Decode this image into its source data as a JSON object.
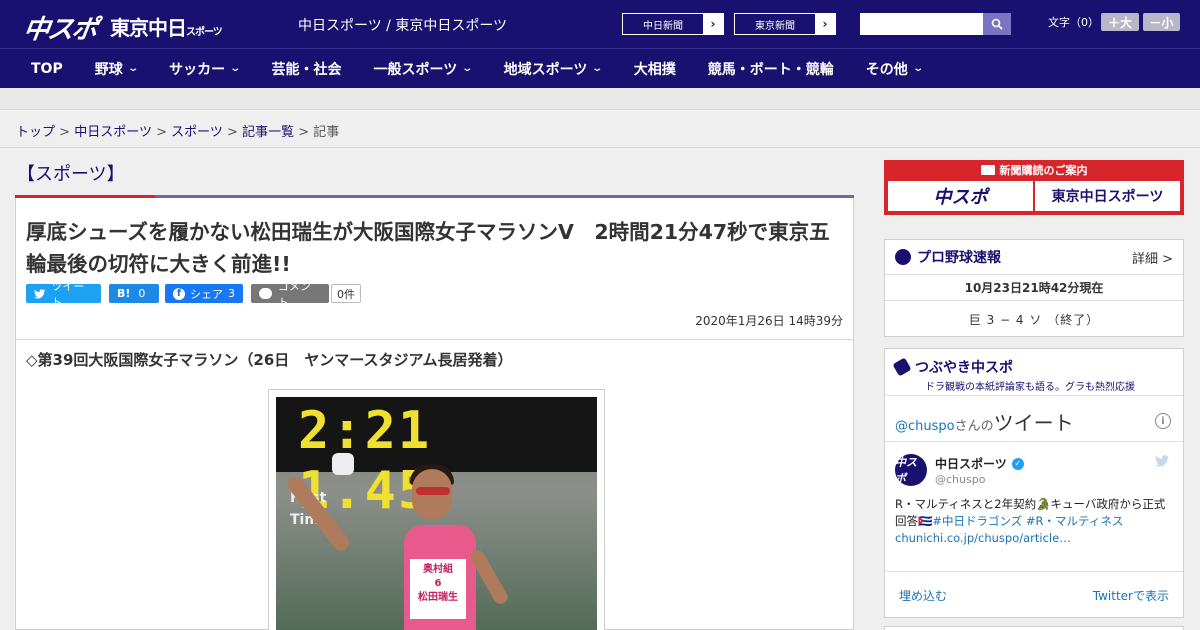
{
  "header": {
    "logo_chuspo": "中スポ",
    "logo_tokyo": "東京中日",
    "logo_tokyo_small": "スポーツ",
    "site_links": "中日スポーツ / 東京中日スポーツ",
    "ext_links": [
      {
        "label": "中日新聞"
      },
      {
        "label": "東京新聞"
      }
    ],
    "search_placeholder": "",
    "font_size_label": "文字（0）",
    "font_larger": "＋大",
    "font_smaller": "－小"
  },
  "nav": {
    "items": [
      {
        "label": "TOP",
        "dropdown": false
      },
      {
        "label": "野球",
        "dropdown": true
      },
      {
        "label": "サッカー",
        "dropdown": true
      },
      {
        "label": "芸能・社会",
        "dropdown": false
      },
      {
        "label": "一般スポーツ",
        "dropdown": true
      },
      {
        "label": "地域スポーツ",
        "dropdown": true
      },
      {
        "label": "大相撲",
        "dropdown": false
      },
      {
        "label": "競馬・ボート・競輪",
        "dropdown": false
      },
      {
        "label": "その他",
        "dropdown": true
      }
    ]
  },
  "breadcrumb": {
    "items": [
      "トップ",
      "中日スポーツ",
      "スポーツ",
      "記事一覧"
    ],
    "current": "記事",
    "sep": ">"
  },
  "article": {
    "section": "【スポーツ】",
    "headline": "厚底シューズを履かない松田瑞生が大阪国際女子マラソンV　2時間21分47秒で東京五輪最後の切符に大きく前進!!",
    "share": {
      "tweet": "ツイート",
      "hatena_label": "B!",
      "hatena_count": "0",
      "facebook": "シェア",
      "facebook_count": "3",
      "comment": "コメント",
      "comment_count": "0件"
    },
    "date": "2020年1月26日 14時39分",
    "lead": "◇第39回大阪国際女子マラソン（26日　ヤンマースタジアム長居発着）",
    "photo": {
      "clock": "2:21 1.45",
      "sign_line1": "First",
      "sign_line2": "Time",
      "bib_line1": "奥村組",
      "bib_line2": "6",
      "bib_line3": "松田瑞生"
    }
  },
  "sidebar": {
    "ad_title": "新聞購読のご案内",
    "ad_chuspo": "中スポ",
    "ad_tokyo": "東京中日スポーツ",
    "baseball": {
      "title": "プロ野球速報",
      "more": "詳細 >",
      "time": "10月23日21時42分現在",
      "score": "巨 3 − 4 ソ （終了）"
    },
    "tweets": {
      "title": "つぶやき中スポ",
      "subtitle": "ドラ観戦の本紙評論家も語る。グラも熱烈応援",
      "handle": "@chuspo",
      "handle_suffix": "さんの",
      "handle_big": "ツイート",
      "info": "i",
      "name": "中日スポーツ",
      "user": "@chuspo",
      "avatar": "中スポ",
      "text_plain": "R・マルティネスと2年契約🐊キューバ政府から正式回答🇨🇺",
      "text_tags": "#中日ドラゴンズ #R・マルティネス",
      "text_link": "chunichi.co.jp/chuspo/article…",
      "embed": "埋め込む",
      "view": "Twitterで表示"
    }
  }
}
